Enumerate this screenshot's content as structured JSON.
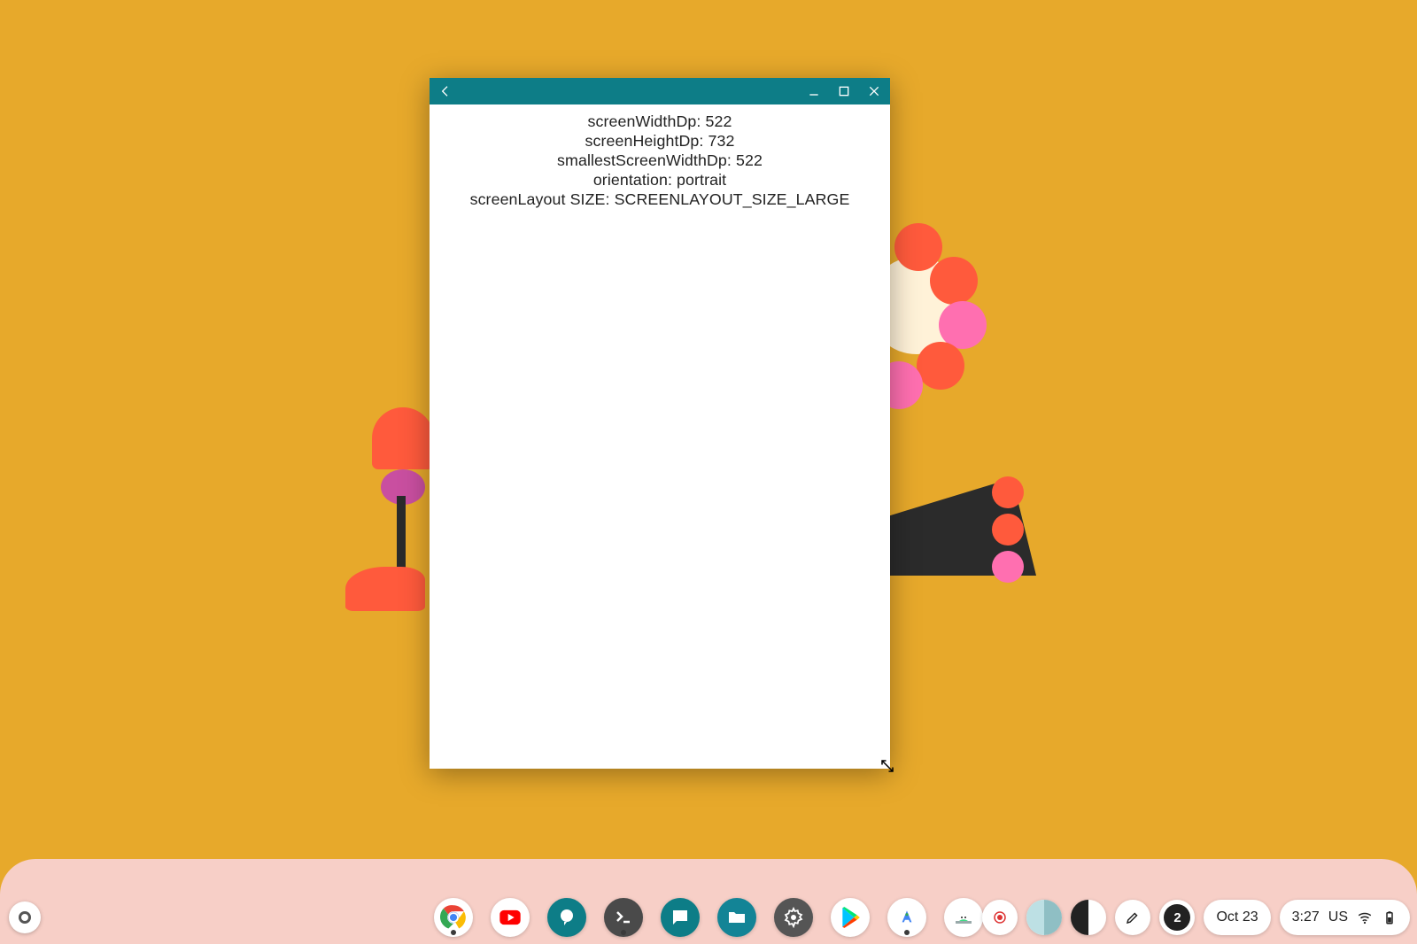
{
  "window": {
    "props": [
      {
        "label": "screenWidthDp",
        "value": "522"
      },
      {
        "label": "screenHeightDp",
        "value": "732"
      },
      {
        "label": "smallestScreenWidthDp",
        "value": "522"
      },
      {
        "label": "orientation",
        "value": "portrait"
      },
      {
        "label": "screenLayout SIZE",
        "value": "SCREENLAYOUT_SIZE_LARGE"
      }
    ]
  },
  "shelf": {
    "apps": [
      {
        "name": "chrome"
      },
      {
        "name": "youtube"
      },
      {
        "name": "chat"
      },
      {
        "name": "terminal"
      },
      {
        "name": "messages"
      },
      {
        "name": "files"
      },
      {
        "name": "settings"
      },
      {
        "name": "play-store"
      },
      {
        "name": "android-studio"
      },
      {
        "name": "emulator"
      }
    ]
  },
  "status": {
    "notification_count": "2",
    "date": "Oct 23",
    "time": "3:27",
    "keyboard": "US"
  }
}
